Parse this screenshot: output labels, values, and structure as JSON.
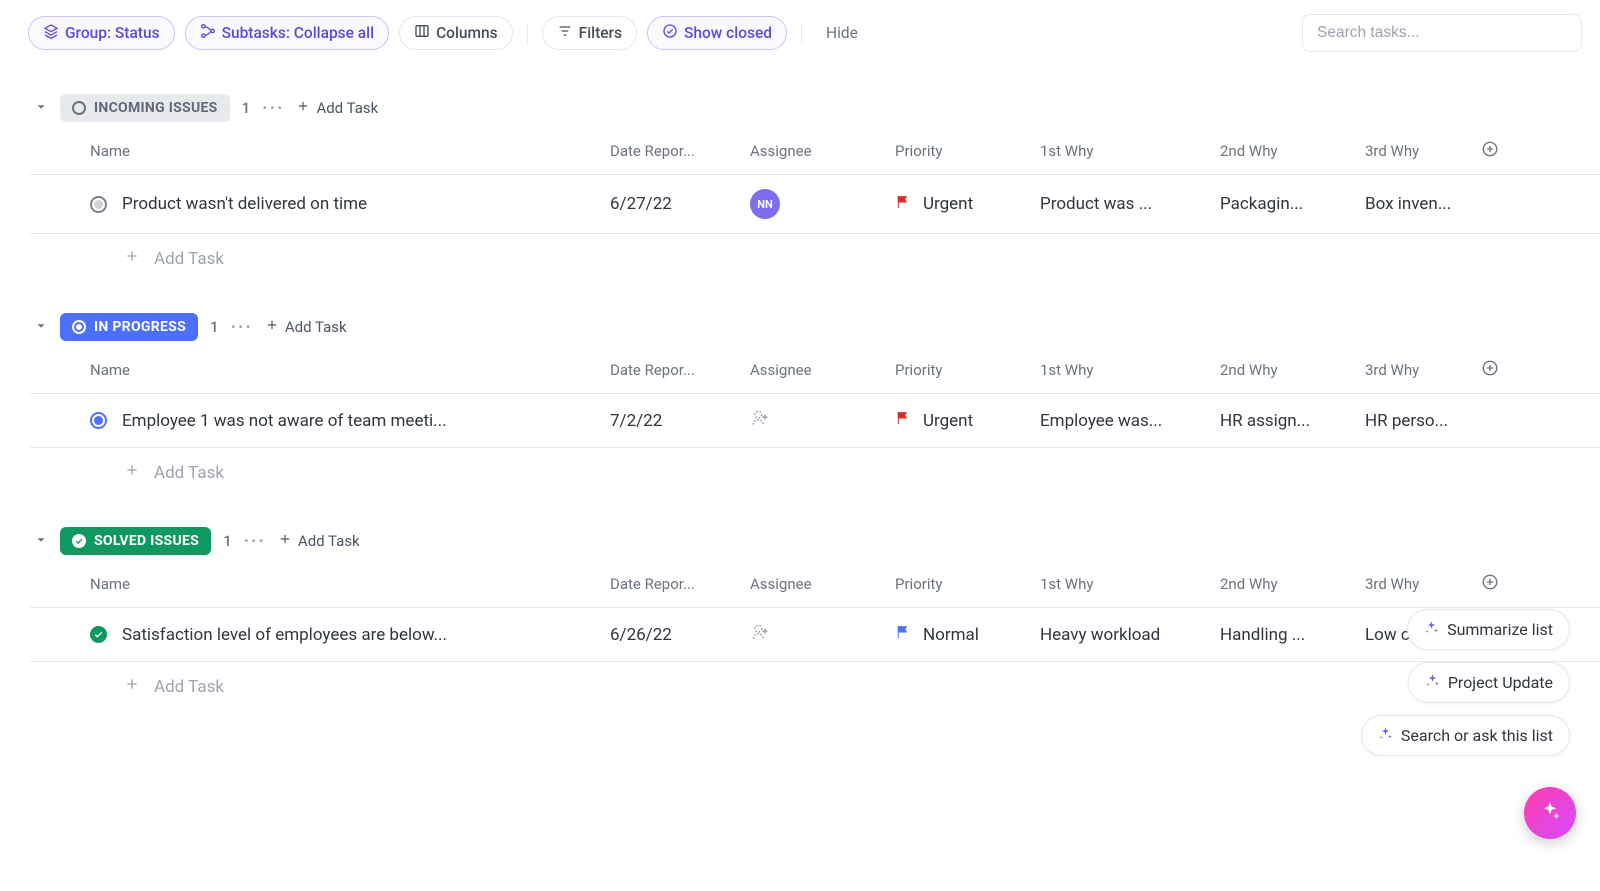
{
  "toolbar": {
    "group_label": "Group: Status",
    "subtasks_label": "Subtasks: Collapse all",
    "columns_label": "Columns",
    "filters_label": "Filters",
    "show_closed_label": "Show closed",
    "hide_label": "Hide",
    "search_placeholder": "Search tasks..."
  },
  "columns": {
    "name": "Name",
    "date": "Date Repor...",
    "assignee": "Assignee",
    "priority": "Priority",
    "why1": "1st Why",
    "why2": "2nd Why",
    "why3": "3rd Why"
  },
  "add_task_label": "Add Task",
  "more_label": "···",
  "groups": [
    {
      "key": "incoming",
      "label": "INCOMING ISSUES",
      "style": "gray",
      "count": "1",
      "tasks": [
        {
          "status": "open",
          "name": "Product wasn't delivered on time",
          "date": "6/27/22",
          "assignee_type": "avatar",
          "assignee_initials": "NN",
          "priority": {
            "level": "urgent",
            "label": "Urgent",
            "color": "#D0312D"
          },
          "why1": "Product was ...",
          "why2": "Packagin...",
          "why3": "Box inven..."
        }
      ]
    },
    {
      "key": "in_progress",
      "label": "IN PROGRESS",
      "style": "blue",
      "count": "1",
      "tasks": [
        {
          "status": "inprog",
          "name": "Employee 1 was not aware of team meeti...",
          "date": "7/2/22",
          "assignee_type": "empty",
          "priority": {
            "level": "urgent",
            "label": "Urgent",
            "color": "#D0312D"
          },
          "why1": "Employee was...",
          "why2": "HR assign...",
          "why3": "HR perso..."
        }
      ]
    },
    {
      "key": "solved",
      "label": "SOLVED ISSUES",
      "style": "green",
      "count": "1",
      "tasks": [
        {
          "status": "done",
          "name": "Satisfaction level of employees are below...",
          "date": "6/26/22",
          "assignee_type": "empty",
          "priority": {
            "level": "normal",
            "label": "Normal",
            "color": "#4B6FFF"
          },
          "why1": "Heavy workload",
          "why2": "Handling ...",
          "why3": "Low capa..."
        }
      ]
    }
  ],
  "ai": {
    "suggestions": [
      "Summarize list",
      "Project Update",
      "Search or ask this list"
    ]
  }
}
